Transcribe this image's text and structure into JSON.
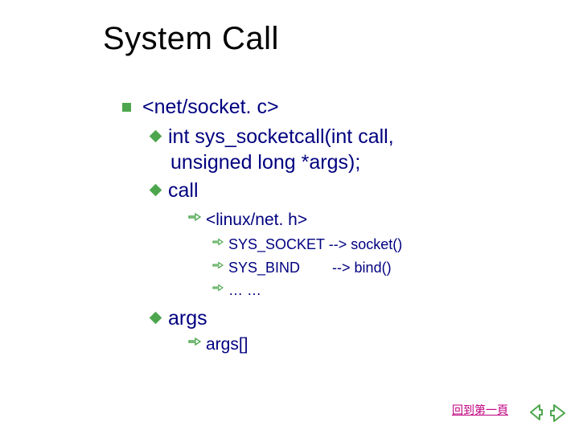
{
  "title": "System Call",
  "items": {
    "file": "<net/socket. c>",
    "sig_prefix": "int",
    "sig_rest": " sys_socketcall(int call,",
    "sig_line2": "unsigned long *args);",
    "call": "call",
    "header": "<linux/net. h>",
    "map1": "SYS_SOCKET --> socket()",
    "map2": "SYS_BIND        --> bind()",
    "map3": "… …",
    "args": "args",
    "args_arr": "args[]"
  },
  "footer": {
    "back_label": "回到第一頁"
  },
  "nav": {
    "prev": "prev",
    "next": "next"
  },
  "colors": {
    "bullet": "#4da64d",
    "text": "#000080",
    "link": "#c00080"
  }
}
